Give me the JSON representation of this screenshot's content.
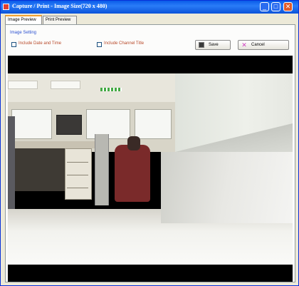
{
  "window": {
    "title": "Capture / Print - Image Size(720 x 480)",
    "controls": {
      "minimize": "_",
      "maximize": "□",
      "close": "✕"
    }
  },
  "tabs": [
    {
      "label": "Image Preview",
      "active": true
    },
    {
      "label": "Print Preview",
      "active": false
    }
  ],
  "image_setting": {
    "group_title": "Image Setting",
    "include_date_time": {
      "label": "Include Date and Time",
      "checked": false
    },
    "include_channel_title": {
      "label": "Include Channel Title",
      "checked": false
    },
    "save_label": "Save",
    "cancel_label": "Cancel",
    "save_icon": "floppy-disk-icon",
    "cancel_icon": "cancel-x-icon"
  },
  "preview": {
    "description_icon": "camera-snapshot"
  },
  "colors": {
    "titlebar": "#0a5ce8",
    "accent_text": "#2a50d0",
    "checkbox_label": "#b84a2a",
    "preview_bg": "#000000"
  }
}
